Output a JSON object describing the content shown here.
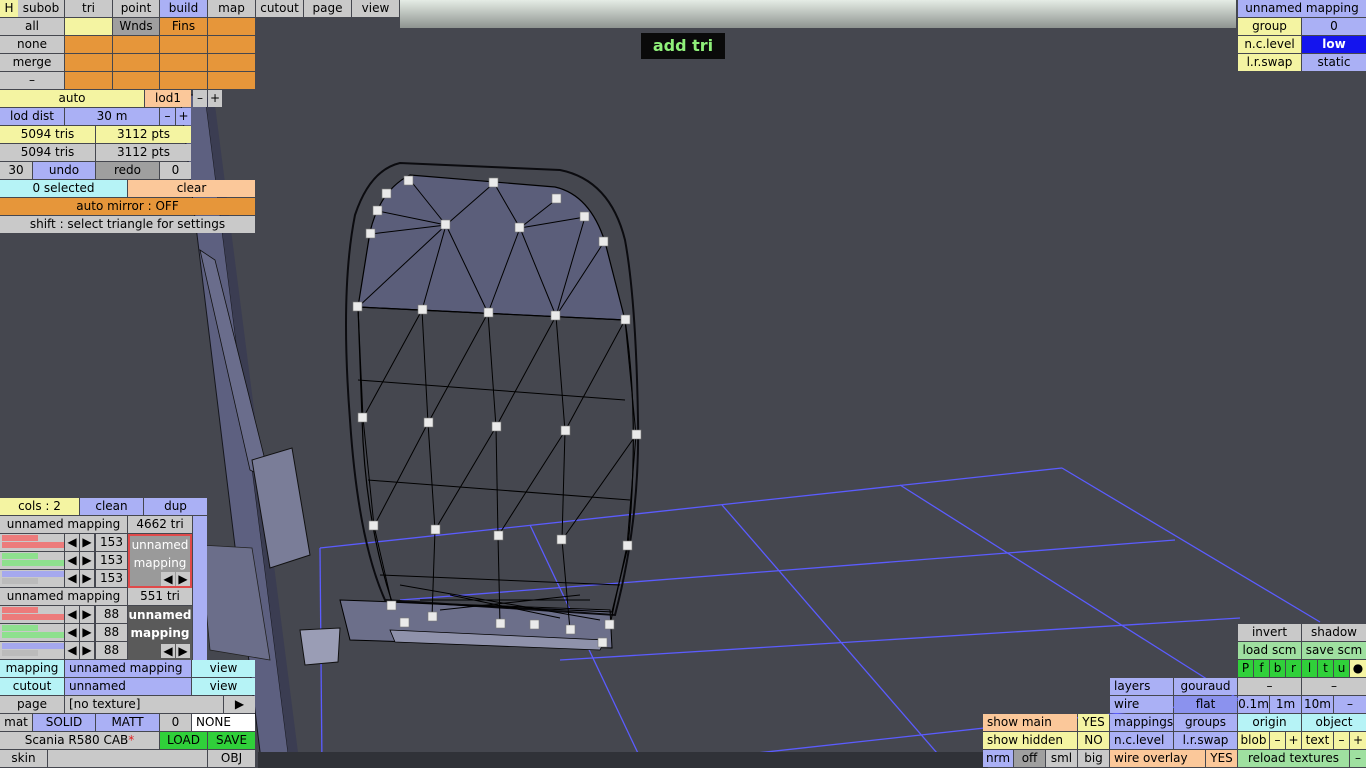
{
  "menu": {
    "h": "H",
    "subob": "subob",
    "tri": "tri",
    "point": "point",
    "build": "build",
    "map": "map",
    "cutout": "cutout",
    "page": "page",
    "view": "view"
  },
  "select": {
    "all": "all",
    "none": "none",
    "merge": "merge",
    "dash": "–",
    "wnds": "Wnds",
    "fins": "Fins"
  },
  "lod": {
    "auto": "auto",
    "lod1": "lod1",
    "minus": "–",
    "plus": "+",
    "lod_dist_label": "lod dist",
    "lod_dist_value": "30 m"
  },
  "stats": {
    "tris1": "5094 tris",
    "pts1": "3112 pts",
    "tris2": "5094 tris",
    "pts2": "3112 pts"
  },
  "undo_row": {
    "count": "30",
    "undo": "undo",
    "redo": "redo",
    "redo_count": "0"
  },
  "selection": {
    "selected": "0 selected",
    "clear": "clear",
    "auto_mirror": "auto mirror : OFF",
    "hint": "shift : select triangle for settings"
  },
  "mode_label": "add tri",
  "mapping_panel": {
    "name": "unnamed mapping",
    "group_label": "group",
    "group_value": "0",
    "nc_level_label": "n.c.level",
    "nc_level_value": "low",
    "lr_swap_label": "l.r.swap",
    "lr_swap_value": "static"
  },
  "cols_panel": {
    "cols": "cols : 2",
    "clean": "clean",
    "dup": "dup",
    "mapping1": {
      "name": "unnamed mapping",
      "tris": "4662 tri",
      "v1": "153",
      "v2": "153",
      "v3": "153",
      "preview_line1": "unnamed",
      "preview_line2": "mapping"
    },
    "mapping2": {
      "name": "unnamed mapping",
      "tris": "551 tri",
      "v1": "88",
      "v2": "88",
      "v3": "88",
      "preview_line1": "unnamed",
      "preview_line2": "mapping"
    },
    "arrow_left": "◀",
    "arrow_right": "▶"
  },
  "bottom_left": {
    "mapping_label": "mapping",
    "mapping_value": "unnamed mapping",
    "view1": "view",
    "cutout_label": "cutout",
    "cutout_value": "unnamed",
    "view2": "view",
    "page_label": "page",
    "page_value": "[no texture]",
    "page_arrow": "▶",
    "mat": "mat",
    "solid": "SOLID",
    "matt": "MATT",
    "mat_num": "0",
    "mat_none": "NONE",
    "model_name": "Scania R580 CAB",
    "modified_mark": "*",
    "load": "LOAD",
    "save": "SAVE",
    "skin": "skin",
    "obj": "OBJ"
  },
  "show_panel": {
    "show_main": "show main",
    "show_main_val": "YES",
    "show_hidden": "show hidden",
    "show_hidden_val": "NO",
    "nrm": "nrm",
    "off": "off",
    "sml": "sml",
    "big": "big"
  },
  "render_panel": {
    "layers": "layers",
    "gouraud": "gouraud",
    "wire": "wire",
    "flat": "flat",
    "mappings": "mappings",
    "groups": "groups",
    "nc_level": "n.c.level",
    "lr_swap": "l.r.swap",
    "wire_overlay": "wire overlay",
    "wire_overlay_val": "YES"
  },
  "right_panel": {
    "invert": "invert",
    "shadow": "shadow",
    "load_scm": "load scm",
    "save_scm": "save scm",
    "flags": [
      "P",
      "f",
      "b",
      "r",
      "l",
      "t",
      "u",
      "●"
    ],
    "dash1": "–",
    "dash2": "–",
    "grid_01": "0.1m",
    "grid_1": "1m",
    "grid_10": "10m",
    "grid_minus": "–",
    "origin": "origin",
    "object": "object",
    "blob": "blob",
    "blob_minus": "–",
    "blob_plus": "+",
    "text": "text",
    "text_minus": "–",
    "text_plus": "+",
    "reload": "reload textures",
    "reload_minus": "–"
  },
  "colors": {
    "background": "#45474f",
    "grid": "#5b5cff",
    "mesh_fill": "#5a5d78",
    "wire": "#000000"
  }
}
